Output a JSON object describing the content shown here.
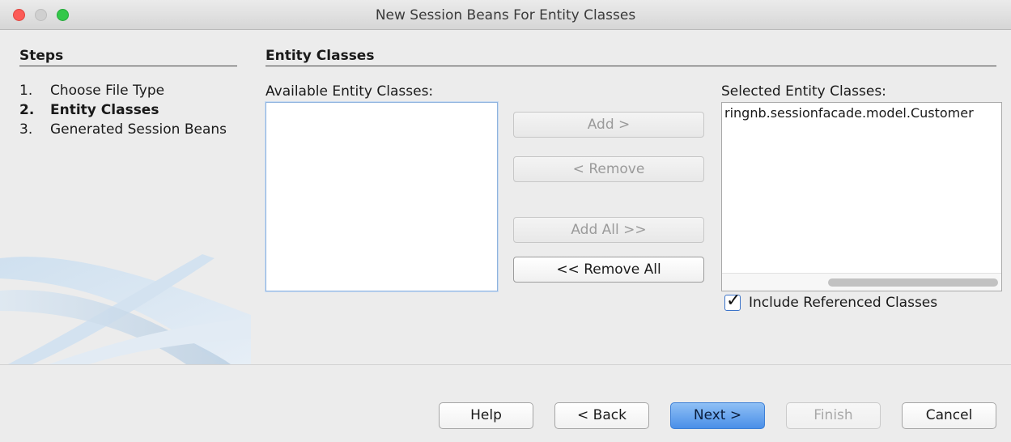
{
  "window": {
    "title": "New Session Beans For Entity Classes"
  },
  "steps": {
    "heading": "Steps",
    "items": [
      {
        "num": "1.",
        "label": "Choose File Type"
      },
      {
        "num": "2.",
        "label": "Entity Classes"
      },
      {
        "num": "3.",
        "label": "Generated Session Beans"
      }
    ],
    "current_index": 1
  },
  "content": {
    "heading": "Entity Classes",
    "available_label": "Available Entity Classes:",
    "available_items": [],
    "selected_label": "Selected Entity Classes:",
    "selected_items": [
      "ringnb.sessionfacade.model.Customer"
    ],
    "buttons": {
      "add": "Add >",
      "remove": "< Remove",
      "add_all": "Add All >>",
      "remove_all": "<< Remove All"
    },
    "include_referenced": {
      "label": "Include Referenced Classes",
      "checked": true
    }
  },
  "footer": {
    "help": "Help",
    "back": "< Back",
    "next": "Next >",
    "finish": "Finish",
    "cancel": "Cancel"
  }
}
